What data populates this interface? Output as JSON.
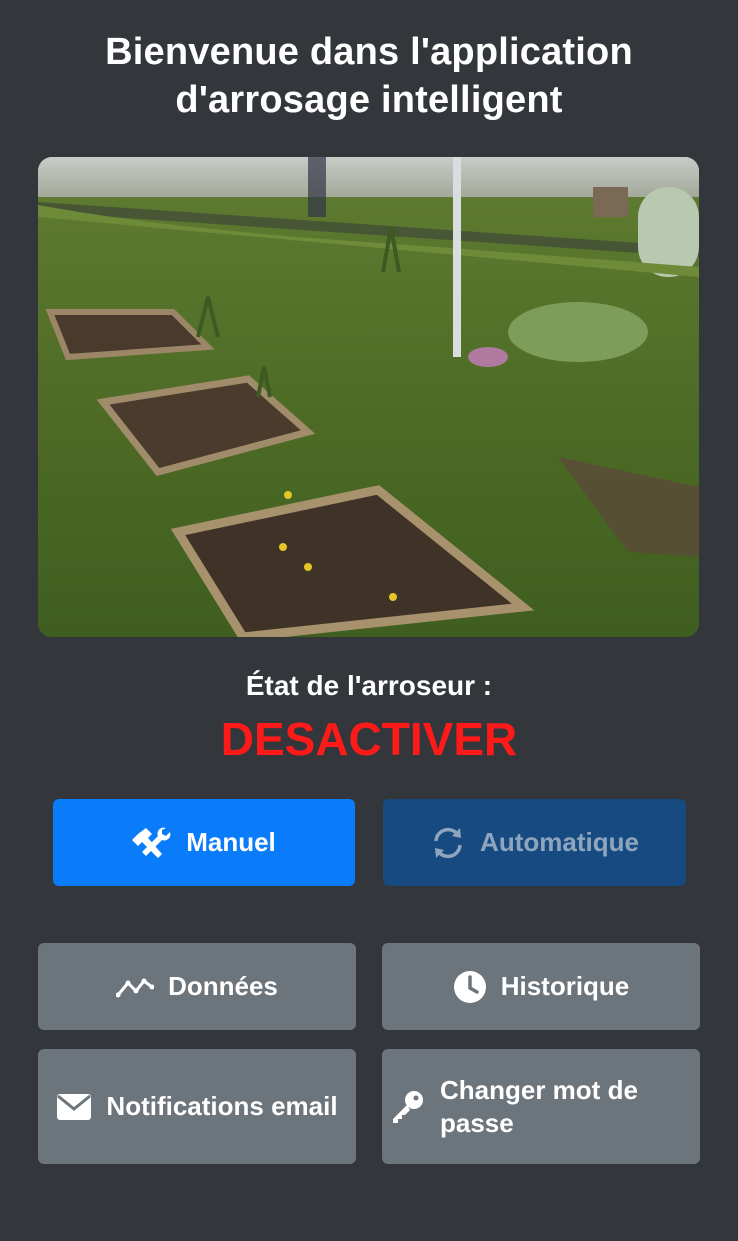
{
  "header": {
    "title_line1": "Bienvenue dans l'application",
    "title_line2": "d'arrosage intelligent"
  },
  "sprinkler": {
    "label": "État de l'arroseur :",
    "status": "DESACTIVER",
    "status_color": "#ff1a1a"
  },
  "mode": {
    "manual_label": "Manuel",
    "auto_label": "Automatique",
    "manual_color": "#0a7cf9",
    "auto_color": "#174a80"
  },
  "menu": {
    "data_label": "Données",
    "history_label": "Historique",
    "notifications_label": "Notifications email",
    "password_line1": "Changer mot de",
    "password_line2": "passe"
  }
}
